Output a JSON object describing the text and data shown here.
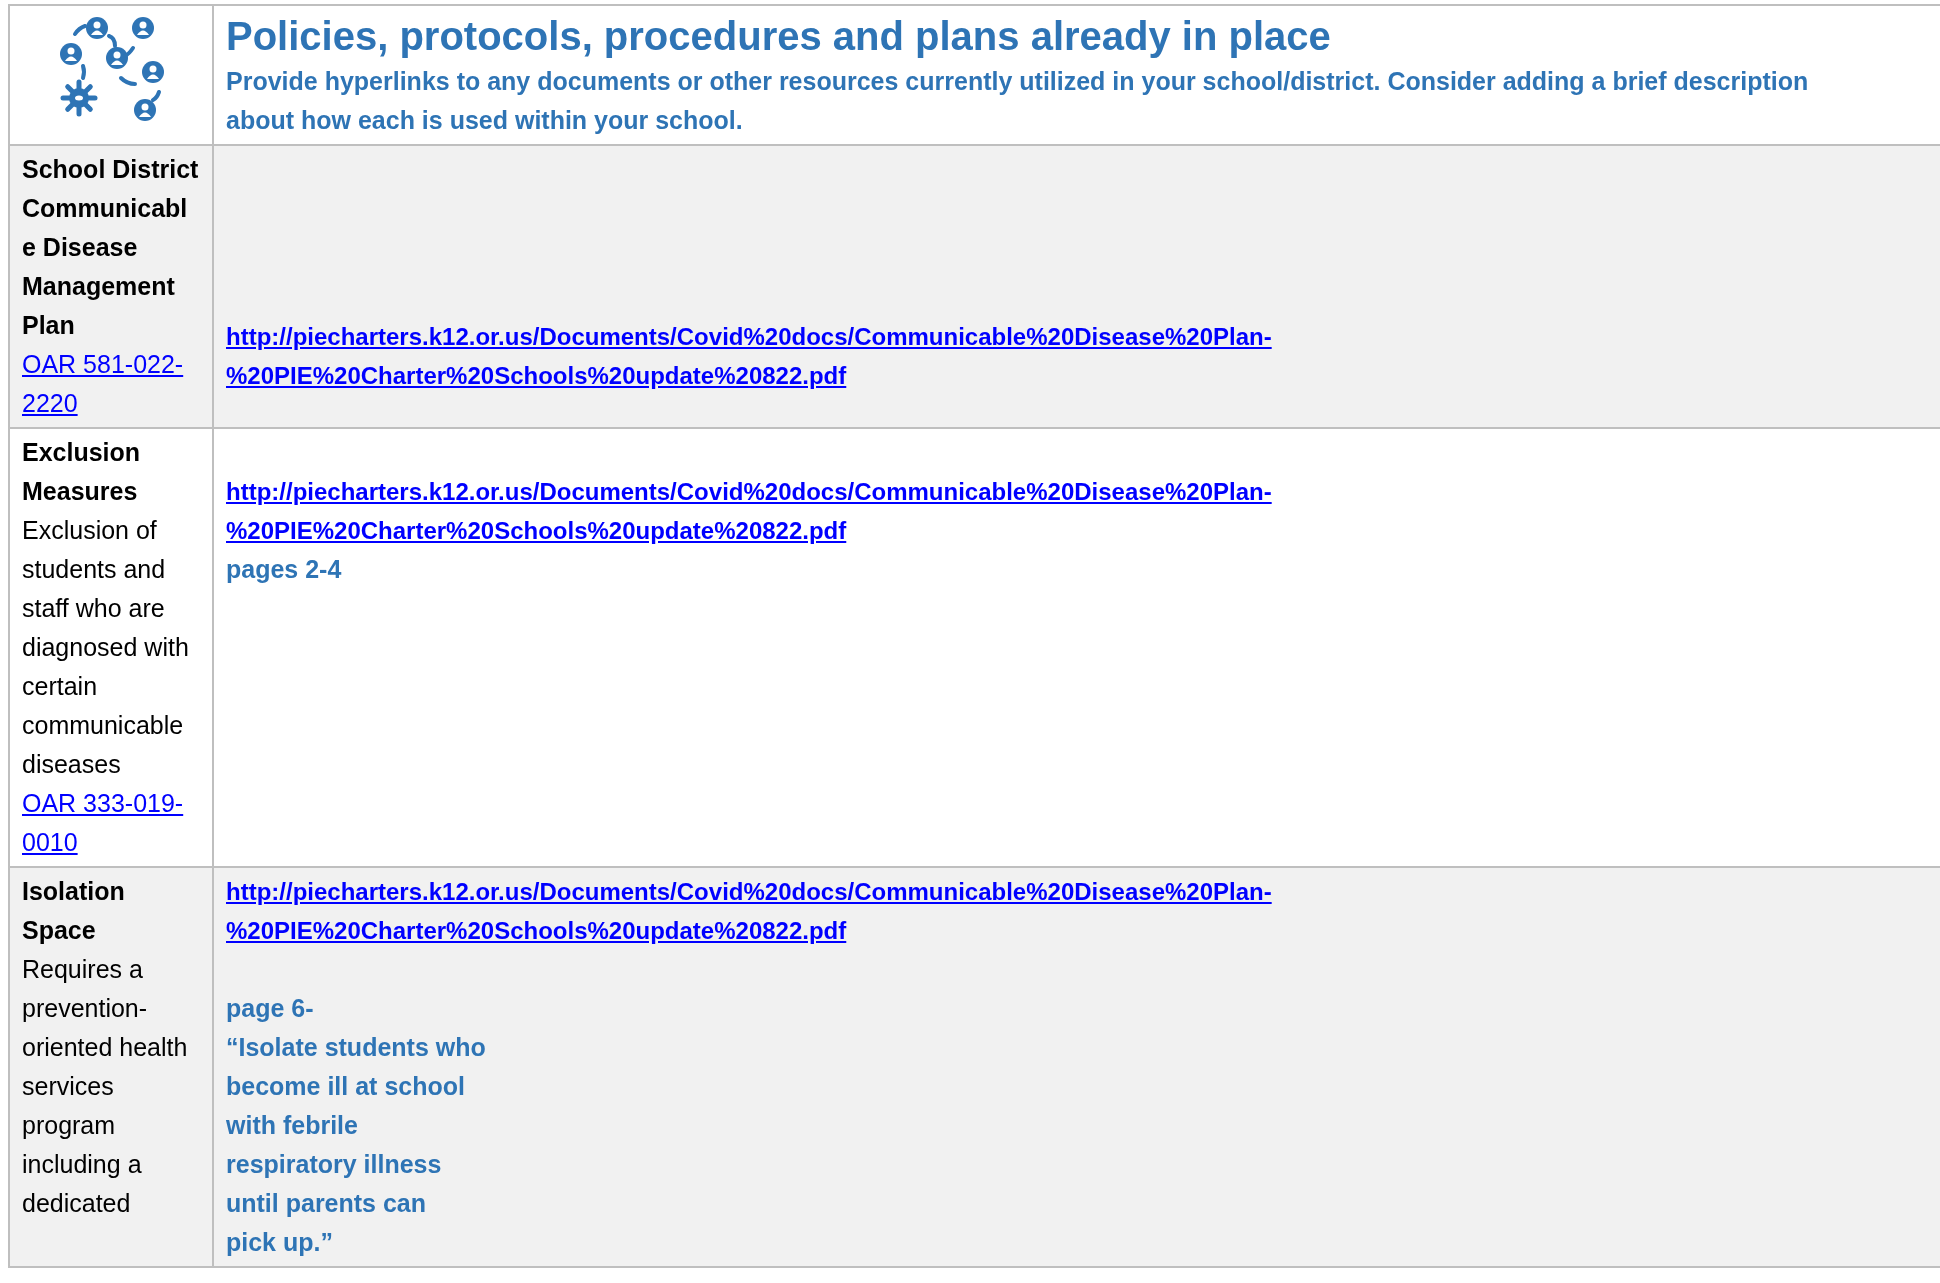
{
  "header": {
    "title": "Policies, protocols, procedures and plans already in place",
    "subtitle": "Provide hyperlinks to any documents or other resources currently utilized in your school/district. Consider adding a brief description about how each is used within your school."
  },
  "rows": [
    {
      "title": "School District Communicable Disease Management Plan",
      "description": "",
      "reference": "OAR 581-022-2220",
      "links": [
        "http://piecharters.k12.or.us/Documents/Covid%20docs/Communicable%20Disease%20Plan-%20PIE%20Charter%20Schools%20update%20822.pdf"
      ],
      "notes": []
    },
    {
      "title": "Exclusion Measures",
      "description": "Exclusion of students and staff who are diagnosed with certain communicable diseases",
      "reference": "OAR 333-019-0010",
      "links": [
        "http://piecharters.k12.or.us/Documents/Covid%20docs/Communicable%20Disease%20Plan-%20PIE%20Charter%20Schools%20update%20822.pdf"
      ],
      "notes": [
        "pages 2-4"
      ]
    },
    {
      "title": "Isolation Space",
      "description": "Requires a prevention-oriented health services program including a dedicated",
      "reference": "",
      "links": [
        "http://piecharters.k12.or.us/Documents/Covid%20docs/Communicable%20Disease%20Plan-%20PIE%20Charter%20Schools%20update%20822.pdf"
      ],
      "notes": [
        "page 6-",
        "“Isolate students who",
        "become ill at school",
        "with febrile",
        "respiratory illness",
        "until parents can",
        "pick up.”"
      ]
    }
  ]
}
